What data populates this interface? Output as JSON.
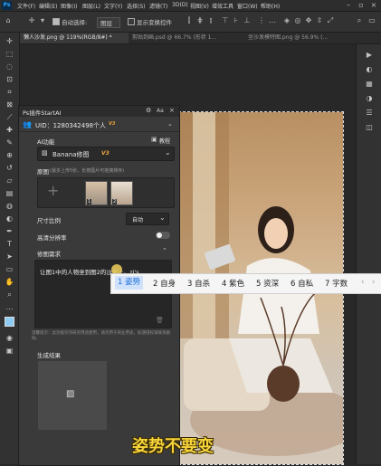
{
  "menubar": {
    "logo": "Ps",
    "items": [
      "文件(F)",
      "编辑(E)",
      "图像(I)",
      "图层(L)",
      "文字(Y)",
      "选择(S)",
      "滤镜(T)",
      "3D(D)",
      "视图(V)",
      "增效工具",
      "窗口(W)",
      "帮助(H)"
    ]
  },
  "options": {
    "auto_select_label": "自动选择:",
    "auto_select_value": "图层",
    "show_transform_label": "显示变换控件"
  },
  "tabs": [
    "懒人沙发.png @ 119%(RGB/8#) *",
    "剪贴到画.psd @ 66.7% (形状 1...",
    "坐沙发模特图.png @ 56.9% (..."
  ],
  "plugin": {
    "title": "Ps插件StartAI",
    "uid_text": "UID：1280342498",
    "account_type": "个人",
    "version_badge": "V3",
    "ai_section": "AI功能",
    "tutorial": "教程",
    "model_name": "Banana修图",
    "model_badge": "V3",
    "original_label": "原图",
    "original_hint": "(最多上传5张，长按图片可拖拽排序)",
    "thumb1_number": "1",
    "thumb2_number": "2",
    "ratio_label": "尺寸比例",
    "ratio_value": "自动",
    "hires_label": "高清分辨率",
    "hires_enabled": false,
    "prompt_label": "修图需求",
    "prompt_text": "让图1中的人物坐到图2的沙发上。zi's",
    "notice": "温馨提示：此功能仅作研究用途使用，请勿用于商业用途，如遇侵权请联系删除。",
    "result_label": "生成结果"
  },
  "ime": {
    "candidates": [
      "1 姿势",
      "2 自身",
      "3 自杀",
      "4 紫色",
      "5 资深",
      "6 自私",
      "7 字数"
    ]
  },
  "subtitle": "姿势不要变",
  "colors": {
    "accent": "#31a8ff",
    "badge": "#e8a33d",
    "subtitle": "#f6d43b"
  }
}
